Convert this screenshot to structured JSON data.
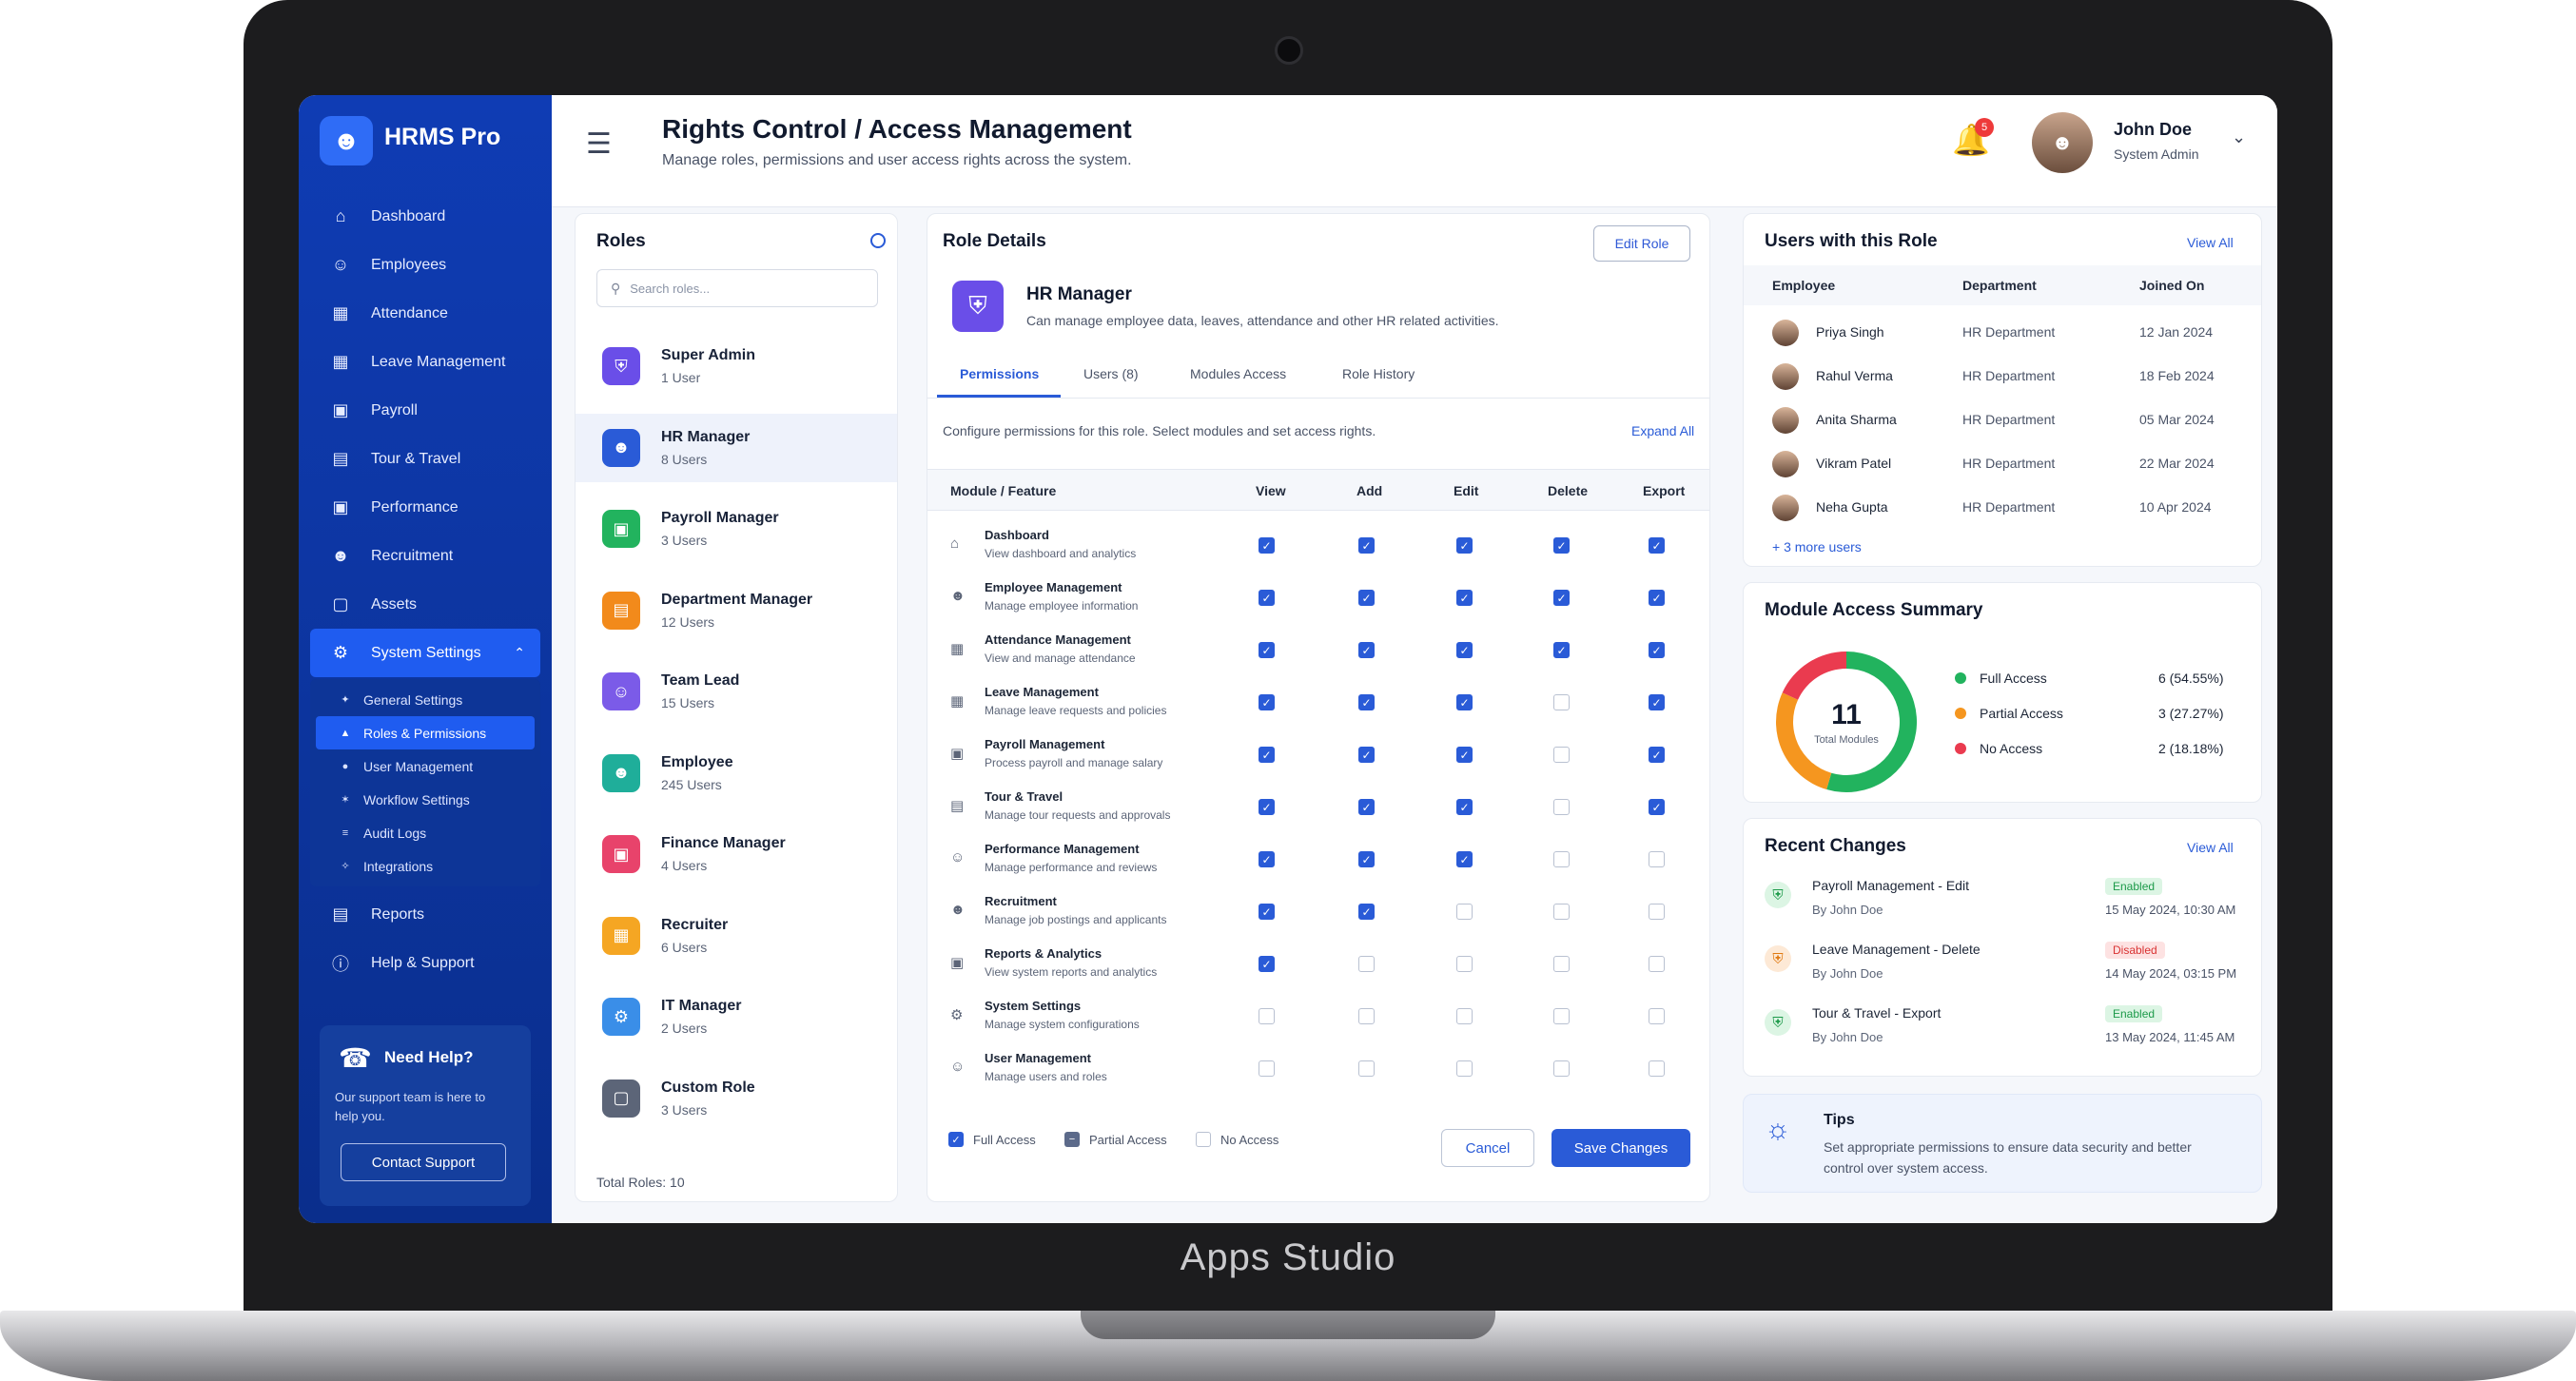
{
  "device": {
    "brand": "Apps Studio"
  },
  "app": {
    "name": "HRMS Pro"
  },
  "sidebar": {
    "items": [
      {
        "label": "Dashboard",
        "icon": "home-icon"
      },
      {
        "label": "Employees",
        "icon": "users-icon"
      },
      {
        "label": "Attendance",
        "icon": "calendar-icon"
      },
      {
        "label": "Leave Management",
        "icon": "calendar-check-icon"
      },
      {
        "label": "Payroll",
        "icon": "money-icon"
      },
      {
        "label": "Tour & Travel",
        "icon": "briefcase-icon"
      },
      {
        "label": "Performance",
        "icon": "chart-icon"
      },
      {
        "label": "Recruitment",
        "icon": "user-plus-icon"
      },
      {
        "label": "Assets",
        "icon": "box-icon"
      },
      {
        "label": "System Settings",
        "icon": "settings-icon"
      }
    ],
    "sub_items": [
      {
        "label": "General Settings"
      },
      {
        "label": "Roles & Permissions"
      },
      {
        "label": "User Management"
      },
      {
        "label": "Workflow Settings"
      },
      {
        "label": "Audit Logs"
      },
      {
        "label": "Integrations"
      }
    ],
    "bottom_items": [
      {
        "label": "Reports",
        "icon": "reports-icon"
      },
      {
        "label": "Help & Support",
        "icon": "help-icon"
      }
    ],
    "help": {
      "title": "Need Help?",
      "desc": "Our support team is here to help you.",
      "button": "Contact Support"
    }
  },
  "header": {
    "title": "Rights Control / Access Management",
    "subtitle": "Manage roles, permissions and user access rights across the system.",
    "notification_count": "5",
    "user_name": "John Doe",
    "user_role": "System Admin"
  },
  "roles": {
    "title": "Roles",
    "search_placeholder": "Search roles...",
    "items": [
      {
        "name": "Super Admin",
        "users": "1 User",
        "color": "#6a4ee8"
      },
      {
        "name": "HR Manager",
        "users": "8 Users",
        "color": "#2a5bd7"
      },
      {
        "name": "Payroll Manager",
        "users": "3 Users",
        "color": "#22b35e"
      },
      {
        "name": "Department Manager",
        "users": "12 Users",
        "color": "#f28a1b"
      },
      {
        "name": "Team Lead",
        "users": "15 Users",
        "color": "#7b5be8"
      },
      {
        "name": "Employee",
        "users": "245 Users",
        "color": "#1fae9a"
      },
      {
        "name": "Finance Manager",
        "users": "4 Users",
        "color": "#e8436b"
      },
      {
        "name": "Recruiter",
        "users": "6 Users",
        "color": "#f5a623"
      },
      {
        "name": "IT Manager",
        "users": "2 Users",
        "color": "#3a8ee8"
      },
      {
        "name": "Custom Role",
        "users": "3 Users",
        "color": "#5c6578"
      }
    ],
    "total": "Total Roles: 10"
  },
  "details": {
    "title": "Role Details",
    "edit_label": "Edit Role",
    "role_name": "HR Manager",
    "role_desc": "Can manage employee data, leaves, attendance and other HR related activities.",
    "tabs": [
      "Permissions",
      "Users (8)",
      "Modules Access",
      "Role History"
    ],
    "config_text": "Configure permissions for this role. Select modules and set access rights.",
    "expand_label": "Expand All",
    "columns": [
      "Module / Feature",
      "View",
      "Add",
      "Edit",
      "Delete",
      "Export"
    ],
    "modules": [
      {
        "name": "Dashboard",
        "desc": "View dashboard and analytics",
        "perms": [
          1,
          1,
          1,
          1,
          1
        ]
      },
      {
        "name": "Employee Management",
        "desc": "Manage employee information",
        "perms": [
          1,
          1,
          1,
          1,
          1
        ]
      },
      {
        "name": "Attendance Management",
        "desc": "View and manage attendance",
        "perms": [
          1,
          1,
          1,
          1,
          1
        ]
      },
      {
        "name": "Leave Management",
        "desc": "Manage leave requests and policies",
        "perms": [
          1,
          1,
          1,
          0,
          1
        ]
      },
      {
        "name": "Payroll Management",
        "desc": "Process payroll and manage salary",
        "perms": [
          1,
          1,
          1,
          0,
          1
        ]
      },
      {
        "name": "Tour & Travel",
        "desc": "Manage tour requests and approvals",
        "perms": [
          1,
          1,
          1,
          0,
          1
        ]
      },
      {
        "name": "Performance Management",
        "desc": "Manage performance and reviews",
        "perms": [
          1,
          1,
          1,
          0,
          0
        ]
      },
      {
        "name": "Recruitment",
        "desc": "Manage job postings and applicants",
        "perms": [
          1,
          1,
          0,
          0,
          0
        ]
      },
      {
        "name": "Reports & Analytics",
        "desc": "View system reports and analytics",
        "perms": [
          1,
          0,
          0,
          0,
          0
        ]
      },
      {
        "name": "System Settings",
        "desc": "Manage system configurations",
        "perms": [
          0,
          0,
          0,
          0,
          0
        ]
      },
      {
        "name": "User Management",
        "desc": "Manage users and roles",
        "perms": [
          0,
          0,
          0,
          0,
          0
        ]
      }
    ],
    "legend": [
      "Full Access",
      "Partial Access",
      "No Access"
    ],
    "cancel_label": "Cancel",
    "save_label": "Save Changes"
  },
  "users_panel": {
    "title": "Users with this Role",
    "view_all": "View All",
    "columns": [
      "Employee",
      "Department",
      "Joined On"
    ],
    "rows": [
      {
        "name": "Priya Singh",
        "dept": "HR Department",
        "date": "12 Jan 2024"
      },
      {
        "name": "Rahul Verma",
        "dept": "HR Department",
        "date": "18 Feb 2024"
      },
      {
        "name": "Anita Sharma",
        "dept": "HR Department",
        "date": "05 Mar 2024"
      },
      {
        "name": "Vikram Patel",
        "dept": "HR Department",
        "date": "22 Mar 2024"
      },
      {
        "name": "Neha Gupta",
        "dept": "HR Department",
        "date": "10 Apr 2024"
      }
    ],
    "more": "+ 3 more users"
  },
  "summary": {
    "title": "Module Access Summary",
    "total": "11",
    "total_label": "Total Modules",
    "items": [
      {
        "label": "Full Access",
        "value": "6 (54.55%)",
        "count": 6,
        "color": "#22b35e"
      },
      {
        "label": "Partial Access",
        "value": "3 (27.27%)",
        "count": 3,
        "color": "#f5961f"
      },
      {
        "label": "No Access",
        "value": "2 (18.18%)",
        "count": 2,
        "color": "#ea3b4f"
      }
    ]
  },
  "changes": {
    "title": "Recent Changes",
    "view_all": "View All",
    "items": [
      {
        "title": "Payroll Management - Edit",
        "by": "By John Doe",
        "status": "Enabled",
        "time": "15 May 2024, 10:30 AM"
      },
      {
        "title": "Leave Management - Delete",
        "by": "By John Doe",
        "status": "Disabled",
        "time": "14 May 2024, 03:15 PM"
      },
      {
        "title": "Tour & Travel - Export",
        "by": "By John Doe",
        "status": "Enabled",
        "time": "13 May 2024, 11:45 AM"
      }
    ]
  },
  "tips": {
    "title": "Tips",
    "desc": "Set appropriate permissions to ensure data security and better control over system access."
  }
}
